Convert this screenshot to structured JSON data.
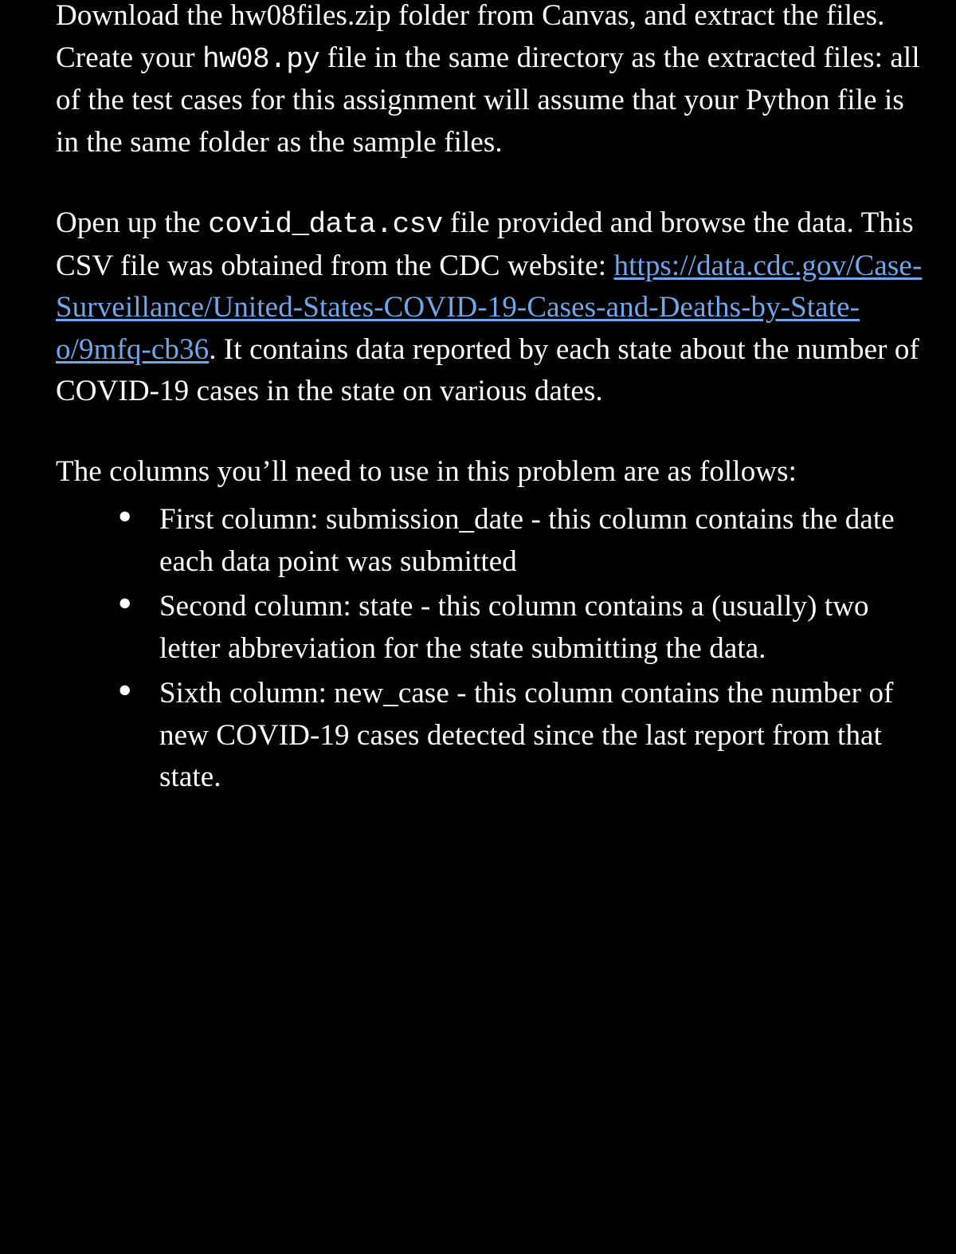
{
  "para1": {
    "t1": "Download the hw08files.zip folder from Canvas, and extract the files.  Create your ",
    "code1": "hw08.py",
    "t2": " file in the same directory as the extracted files: all of the test cases for this assignment will assume that your Python file is in the same folder as the sample files."
  },
  "para2": {
    "t1": "Open up the ",
    "code1": "covid_data.csv",
    "t2": " file provided and browse the data.  This CSV file was obtained from the CDC website: ",
    "link_text": "https://data.cdc.gov/Case-Surveillance/United-States-COVID-19-Cases-and-Deaths-by-State-o/9mfq-cb36",
    "link_href": "https://data.cdc.gov/Case-Surveillance/United-States-COVID-19-Cases-and-Deaths-by-State-o/9mfq-cb36",
    "t3": ".  It contains data reported by each state about the number of COVID-19 cases in the state on various dates."
  },
  "para3": {
    "t1": "The columns you’ll need to use in this problem are as follows:"
  },
  "bullets": [
    "First column: submission_date - this column contains the date each data point was submitted",
    "Second column: state - this column contains a (usually) two letter abbreviation for the state submitting the data.",
    "Sixth column: new_case - this column contains the number of new COVID-19 cases detected since the last report from that state."
  ]
}
